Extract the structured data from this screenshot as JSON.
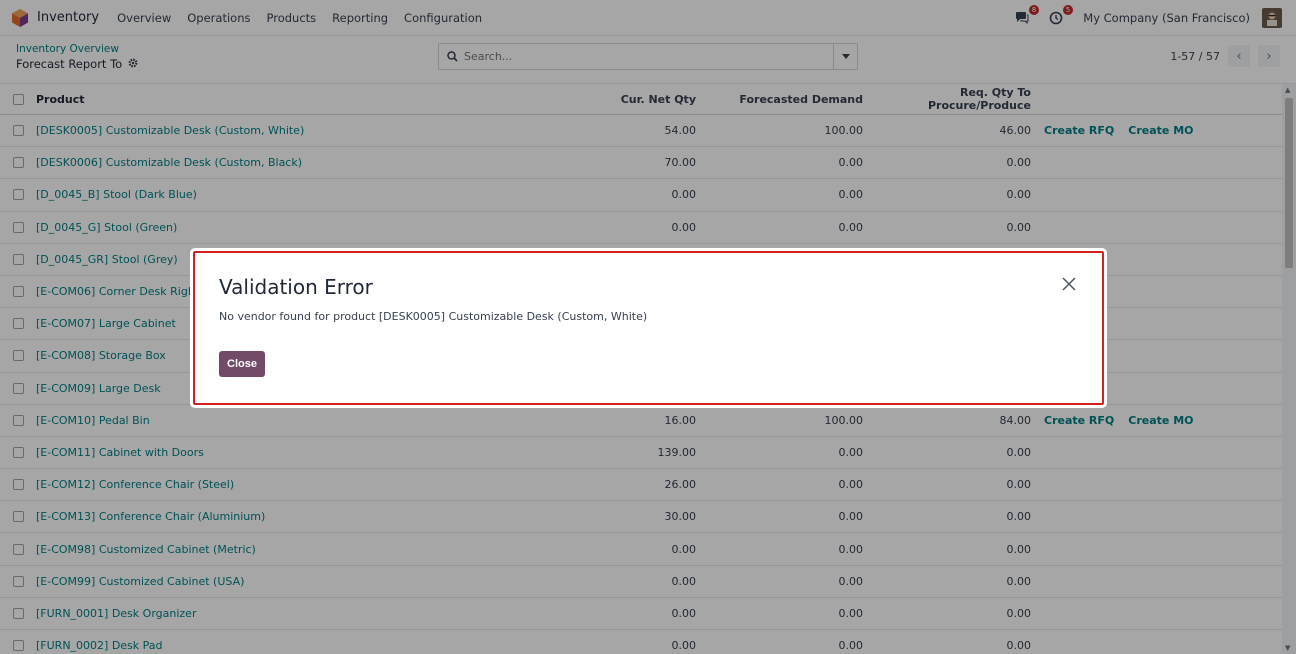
{
  "navbar": {
    "app_name": "Inventory",
    "menu": [
      "Overview",
      "Operations",
      "Products",
      "Reporting",
      "Configuration"
    ],
    "messages_badge": "8",
    "activities_badge": "5",
    "company": "My Company (San Francisco)"
  },
  "control": {
    "breadcrumb": "Inventory Overview",
    "title": "Forecast Report To",
    "search_placeholder": "Search...",
    "pager": "1-57 / 57"
  },
  "table": {
    "headers": {
      "product": "Product",
      "net_qty": "Cur. Net Qty",
      "demand": "Forecasted Demand",
      "req_qty": "Req. Qty To Procure/Produce"
    },
    "rows": [
      {
        "product": "[DESK0005] Customizable Desk (Custom, White)",
        "net": "54.00",
        "demand": "100.00",
        "req": "46.00",
        "rfq": "Create RFQ",
        "mo": "Create MO"
      },
      {
        "product": "[DESK0006] Customizable Desk (Custom, Black)",
        "net": "70.00",
        "demand": "0.00",
        "req": "0.00",
        "rfq": "",
        "mo": ""
      },
      {
        "product": "[D_0045_B] Stool (Dark Blue)",
        "net": "0.00",
        "demand": "0.00",
        "req": "0.00",
        "rfq": "",
        "mo": ""
      },
      {
        "product": "[D_0045_G] Stool (Green)",
        "net": "0.00",
        "demand": "0.00",
        "req": "0.00",
        "rfq": "",
        "mo": ""
      },
      {
        "product": "[D_0045_GR] Stool (Grey)",
        "net": "",
        "demand": "",
        "req": "",
        "rfq": "",
        "mo": ""
      },
      {
        "product": "[E-COM06] Corner Desk Right Sit",
        "net": "",
        "demand": "",
        "req": "",
        "rfq": "",
        "mo": ""
      },
      {
        "product": "[E-COM07] Large Cabinet",
        "net": "",
        "demand": "",
        "req": "",
        "rfq": "",
        "mo": ""
      },
      {
        "product": "[E-COM08] Storage Box",
        "net": "",
        "demand": "",
        "req": "",
        "rfq": "",
        "mo": ""
      },
      {
        "product": "[E-COM09] Large Desk",
        "net": "",
        "demand": "",
        "req": "",
        "rfq": "",
        "mo": ""
      },
      {
        "product": "[E-COM10] Pedal Bin",
        "net": "16.00",
        "demand": "100.00",
        "req": "84.00",
        "rfq": "Create RFQ",
        "mo": "Create MO"
      },
      {
        "product": "[E-COM11] Cabinet with Doors",
        "net": "139.00",
        "demand": "0.00",
        "req": "0.00",
        "rfq": "",
        "mo": ""
      },
      {
        "product": "[E-COM12] Conference Chair (Steel)",
        "net": "26.00",
        "demand": "0.00",
        "req": "0.00",
        "rfq": "",
        "mo": ""
      },
      {
        "product": "[E-COM13] Conference Chair (Aluminium)",
        "net": "30.00",
        "demand": "0.00",
        "req": "0.00",
        "rfq": "",
        "mo": ""
      },
      {
        "product": "[E-COM98] Customized Cabinet (Metric)",
        "net": "0.00",
        "demand": "0.00",
        "req": "0.00",
        "rfq": "",
        "mo": ""
      },
      {
        "product": "[E-COM99] Customized Cabinet (USA)",
        "net": "0.00",
        "demand": "0.00",
        "req": "0.00",
        "rfq": "",
        "mo": ""
      },
      {
        "product": "[FURN_0001] Desk Organizer",
        "net": "0.00",
        "demand": "0.00",
        "req": "0.00",
        "rfq": "",
        "mo": ""
      },
      {
        "product": "[FURN_0002] Desk Pad",
        "net": "0.00",
        "demand": "0.00",
        "req": "0.00",
        "rfq": "",
        "mo": ""
      }
    ]
  },
  "dialog": {
    "title": "Validation Error",
    "message": "No vendor found for product [DESK0005] Customizable Desk (Custom, White)",
    "close_label": "Close"
  },
  "colors": {
    "accent": "#017e84",
    "primary_button": "#714b67",
    "highlight_border": "#d61f1f"
  }
}
